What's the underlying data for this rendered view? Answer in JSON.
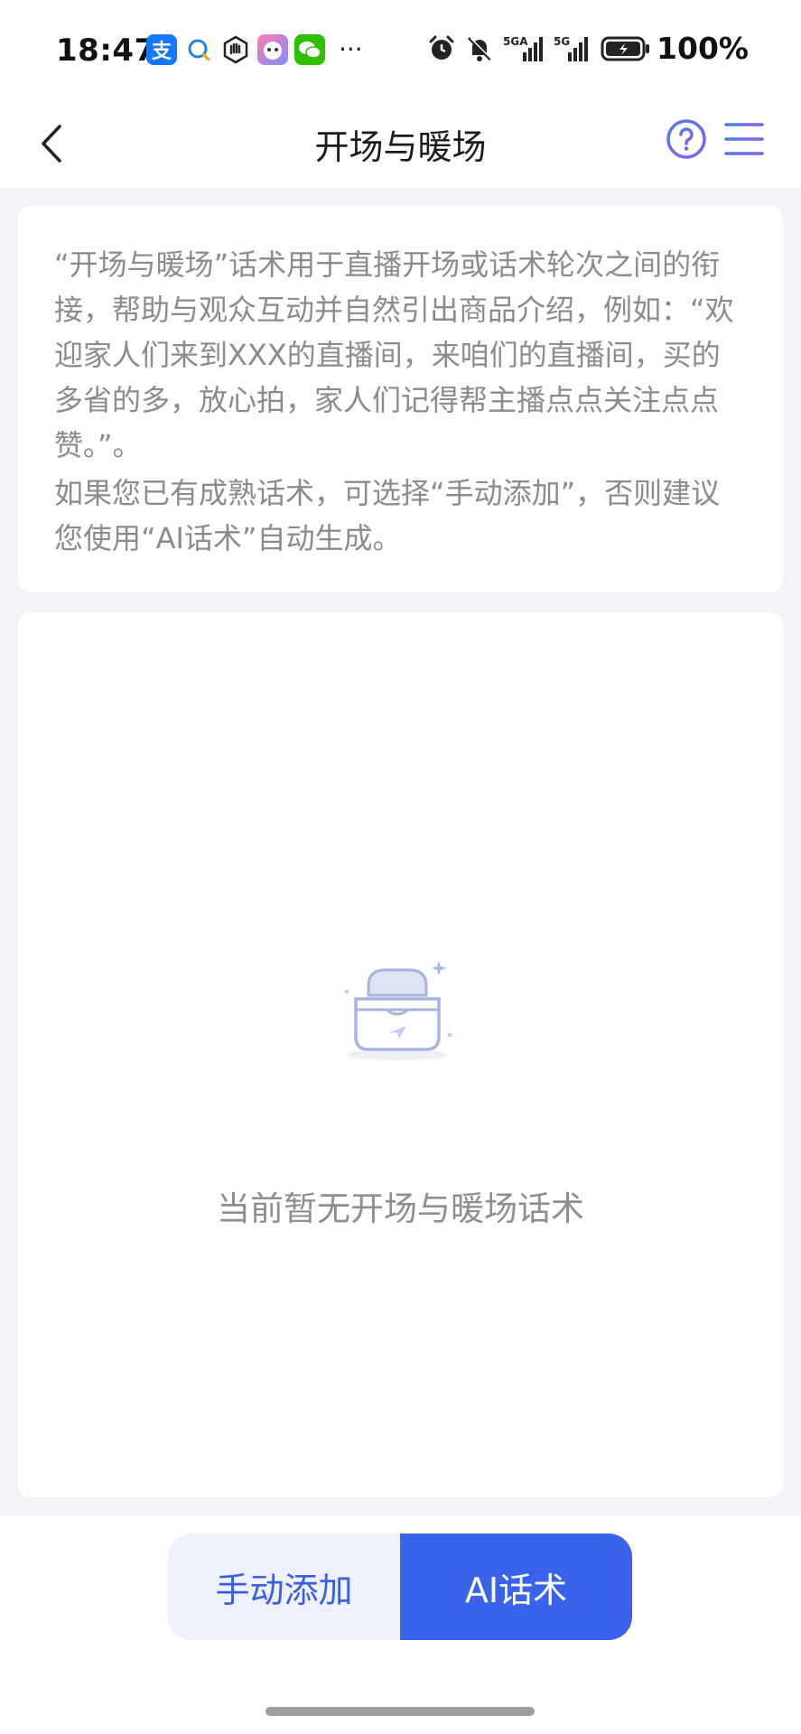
{
  "status_bar": {
    "time": "18:47",
    "battery": "100%",
    "network_1": "5GA",
    "network_2": "5G",
    "alipay_glyph": "支",
    "more": "···",
    "icons_left": [
      "alipay-icon",
      "chat-bubble-icon",
      "hand-icon",
      "mascot-app-icon",
      "wechat-icon"
    ],
    "icons_right": [
      "alarm-icon",
      "mute-bell-icon",
      "signal-5ga-icon",
      "signal-5g-icon",
      "battery-charging-icon"
    ]
  },
  "nav": {
    "title": "开场与暖场",
    "back_icon": "chevron-left-icon",
    "help_icon": "question-circle-icon",
    "menu_icon": "hamburger-menu-icon",
    "accent_color": "#5b6ee8"
  },
  "intro": {
    "paragraph_1": "“开场与暖场”话术用于直播开场或话术轮次之间的衔接，帮助与观众互动并自然引出商品介绍，例如：“欢迎家人们来到XXX的直播间，来咱们的直播间，买的多省的多，放心拍，家人们记得帮主播点点关注点点赞。”。",
    "paragraph_2": "如果您已有成熟话术，可选择“手动添加”，否则建议您使用“AI话术”自动生成。"
  },
  "empty_state": {
    "icon": "empty-inbox-icon",
    "message": "当前暂无开场与暖场话术"
  },
  "actions": {
    "manual_label": "手动添加",
    "ai_label": "AI话术",
    "primary_color": "#3a63ec",
    "secondary_bg": "#eef1fb"
  }
}
